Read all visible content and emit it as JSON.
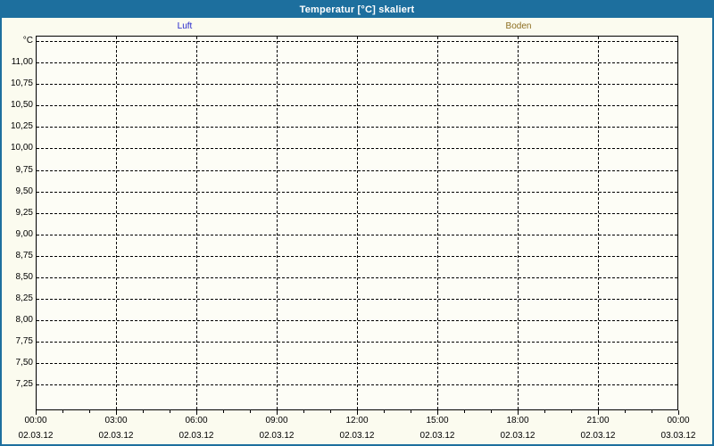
{
  "window": {
    "title": "Temperatur [°C] skaliert"
  },
  "colors": {
    "titlebar_bg": "#1d6f9e",
    "window_border": "#1d6f9e",
    "background": "#fbfbef",
    "plot_background": "#fdfdf6",
    "grid": "#000000",
    "luft_series": "#2626cc",
    "boden_series": "#8c6d1f"
  },
  "chart_data": {
    "type": "line",
    "title": "Temperatur [°C] skaliert",
    "legend_position": "top",
    "grid": "dashed",
    "series": [
      {
        "name": "Luft",
        "color": "#2626cc",
        "values": []
      },
      {
        "name": "Boden",
        "color": "#8c6d1f",
        "values": []
      }
    ],
    "y_axis": {
      "unit_label": "°C",
      "tick_labels": [
        "11,00",
        "10,75",
        "10,50",
        "10,25",
        "10,00",
        "9,75",
        "9,50",
        "9,25",
        "9,00",
        "8,75",
        "8,50",
        "8,25",
        "8,00",
        "7,75",
        "7,50",
        "7,25"
      ],
      "tick_values": [
        11.0,
        10.75,
        10.5,
        10.25,
        10.0,
        9.75,
        9.5,
        9.25,
        9.0,
        8.75,
        8.5,
        8.25,
        8.0,
        7.75,
        7.5,
        7.25
      ],
      "step": 0.25,
      "top_gridline_value": 11.25,
      "ylim_approx": [
        7.0,
        11.3
      ]
    },
    "x_axis": {
      "major_ticks": [
        {
          "time": "00:00",
          "date": "02.03.12"
        },
        {
          "time": "03:00",
          "date": "02.03.12"
        },
        {
          "time": "06:00",
          "date": "02.03.12"
        },
        {
          "time": "09:00",
          "date": "02.03.12"
        },
        {
          "time": "12:00",
          "date": "02.03.12"
        },
        {
          "time": "15:00",
          "date": "02.03.12"
        },
        {
          "time": "18:00",
          "date": "02.03.12"
        },
        {
          "time": "21:00",
          "date": "02.03.12"
        },
        {
          "time": "00:00",
          "date": "03.03.12"
        }
      ],
      "hours_per_major_tick": 3,
      "minor_tick_every_hours": 1,
      "range_hours": 24
    }
  }
}
